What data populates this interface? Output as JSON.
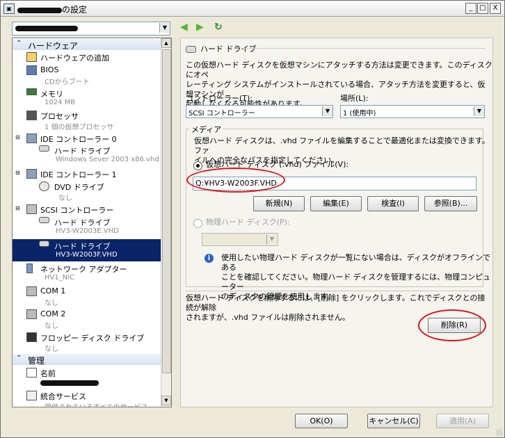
{
  "window": {
    "title": "の設定",
    "min_label": "_",
    "max_label": "□",
    "close_label": "X"
  },
  "left": {
    "vm_selector": {
      "value": ""
    },
    "nav": {
      "back_icon": "back-arrow-icon",
      "forward_icon": "forward-arrow-icon",
      "refresh_icon": "refresh-icon"
    },
    "sections": [
      {
        "label": "ハードウェア"
      },
      {
        "label": "管理"
      }
    ],
    "hardware_items": [
      {
        "label": "ハードウェアの追加",
        "sub": ""
      },
      {
        "label": "BIOS",
        "sub": "CDからブート"
      },
      {
        "label": "メモリ",
        "sub": "1024 MB"
      },
      {
        "label": "プロセッサ",
        "sub": "1 個の仮想プロセッサ"
      },
      {
        "label": "IDE コントローラー 0",
        "sub": ""
      },
      {
        "label": "ハード ドライブ",
        "sub": "Windows Sever 2003 x86.vhd"
      },
      {
        "label": "IDE コントローラー 1",
        "sub": ""
      },
      {
        "label": "DVD ドライブ",
        "sub": "なし"
      },
      {
        "label": "SCSI コントローラー",
        "sub": ""
      },
      {
        "label": "ハード ドライブ",
        "sub": "HV3-W2003E.VHD"
      },
      {
        "label": "ハード ドライブ",
        "sub": "HV3-W2003F.VHD"
      },
      {
        "label": "ネットワーク アダプター",
        "sub": "HV1_NIC"
      },
      {
        "label": "COM 1",
        "sub": "なし"
      },
      {
        "label": "COM 2",
        "sub": "なし"
      },
      {
        "label": "フロッピー ディスク ドライブ",
        "sub": "なし"
      }
    ],
    "management_items": [
      {
        "label": "名前",
        "sub": ""
      },
      {
        "label": "統合サービス",
        "sub": "提供されているすべてのサービス"
      }
    ]
  },
  "right": {
    "header": "ハード ドライブ",
    "intro": [
      "この仮想ハード ディスクを仮想マシンにアタッチする方法は変更できます。このディスクにオペ",
      "レーティング システムがインストールされている場合、アタッチ方法を変更すると、仮想マシンが",
      "起動しなくなる可能性があります。"
    ],
    "controller_label": "コントローラー(T):",
    "controller_value": "SCSI コントローラー",
    "location_label": "場所(L):",
    "location_value": "1 (使用中)",
    "media_label": "メディア",
    "media_desc": [
      "仮想ハード ディスクは、.vhd ファイルを編集することで最適化または変換できます。ファ",
      "イルへの完全なパスを指定してください。"
    ],
    "vhd_radio_label": "仮想ハード ディスク (.vhd) ファイル(V):",
    "vhd_path": "Q:¥HV3-W2003F.VHD",
    "buttons": {
      "new": "新規(N)",
      "edit": "編集(E)",
      "inspect": "検査(I)",
      "browse": "参照(B)..."
    },
    "physical_radio_label": "物理ハード ディスク(P):",
    "physical_value": "",
    "info_text": [
      "使用したい物理ハード ディスクが一覧にない場合は、ディスクがオフラインである",
      "ことを確認してください。物理ハード ディスクを管理するには、物理コンピューター",
      "のディスクの管理を使用します。"
    ],
    "remove_text": [
      "仮想ハード ディスクを削除するには、[削除] をクリックします。これでディスクとの接続が解除",
      "されますが、.vhd ファイルは削除されません。"
    ],
    "remove_button": "削除(R)"
  },
  "footer": {
    "ok": "OK(O)",
    "cancel": "キャンセル(C)",
    "apply": "適用(A)"
  },
  "colors": {
    "selection": "#0a246a",
    "annotation": "#e0101a",
    "section_bg": "#d7e3f2"
  }
}
